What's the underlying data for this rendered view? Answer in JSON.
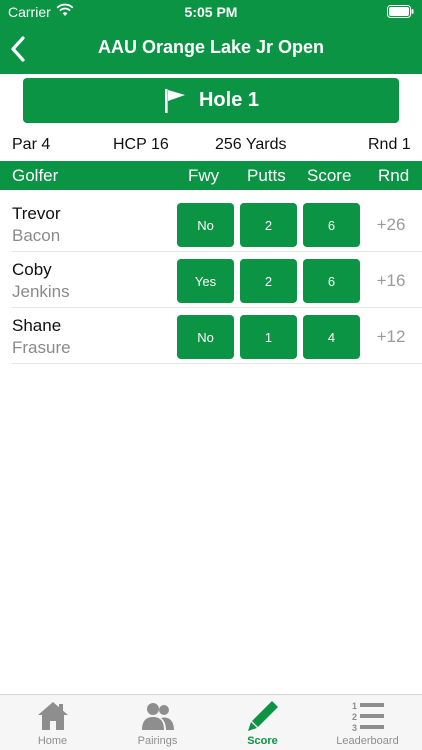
{
  "status": {
    "carrier": "Carrier",
    "time": "5:05 PM"
  },
  "nav": {
    "title": "AAU Orange Lake Jr Open"
  },
  "hole": {
    "label": "Hole 1"
  },
  "info": {
    "par": "Par 4",
    "hcp": "HCP 16",
    "yards": "256 Yards",
    "round": "Rnd 1"
  },
  "headers": {
    "golfer": "Golfer",
    "fwy": "Fwy",
    "putts": "Putts",
    "score": "Score",
    "rnd": "Rnd"
  },
  "players": [
    {
      "first": "Trevor",
      "last": "Bacon",
      "fwy": "No",
      "putts": "2",
      "score": "6",
      "rnd": "+26"
    },
    {
      "first": "Coby",
      "last": "Jenkins",
      "fwy": "Yes",
      "putts": "2",
      "score": "6",
      "rnd": "+16"
    },
    {
      "first": "Shane",
      "last": "Frasure",
      "fwy": "No",
      "putts": "1",
      "score": "4",
      "rnd": "+12"
    }
  ],
  "tabs": [
    {
      "label": "Home",
      "icon": "home-icon"
    },
    {
      "label": "Pairings",
      "icon": "people-icon"
    },
    {
      "label": "Score",
      "icon": "pencil-icon",
      "active": true
    },
    {
      "label": "Leaderboard",
      "icon": "list-icon"
    }
  ],
  "colors": {
    "brand": "#0b9444",
    "inactive": "#8e8e8e"
  }
}
